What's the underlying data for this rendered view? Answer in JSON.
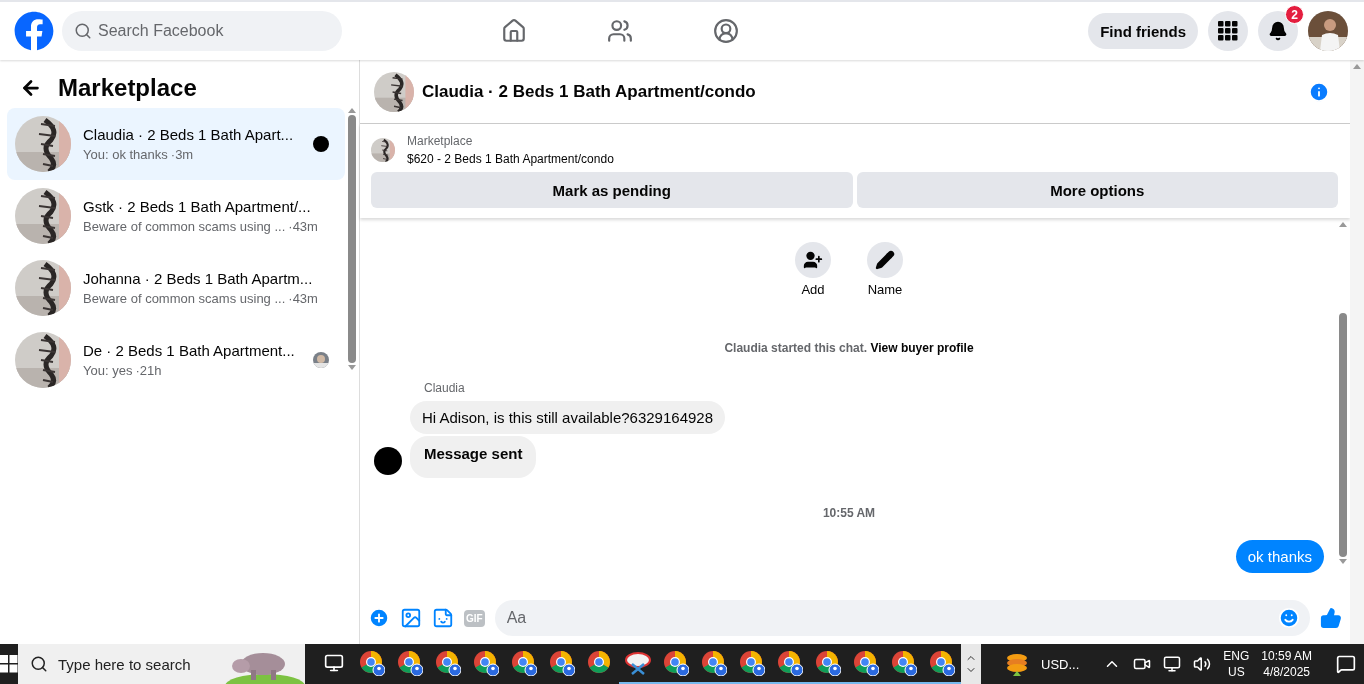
{
  "topbar": {
    "search": {
      "placeholder": "Search Facebook"
    },
    "find_friends": "Find friends",
    "notification_count": "2"
  },
  "sidebar": {
    "title": "Marketplace",
    "conversations": [
      {
        "title": "Claudia · 2 Beds 1 Bath Apart...",
        "preview": "You: ok thanks",
        "time": "·3m",
        "selected": true,
        "kind": "unread"
      },
      {
        "title": "Gstk · 2 Beds 1 Bath Apartment/...",
        "preview": "Beware of common scams using ...",
        "time": "·43m",
        "selected": false,
        "kind": "plain"
      },
      {
        "title": "Johanna · 2 Beds 1 Bath Apartm...",
        "preview": "Beware of common scams using ...",
        "time": "·43m",
        "selected": false,
        "kind": "plain"
      },
      {
        "title": "De · 2 Beds 1 Bath Apartment...",
        "preview": "You: yes",
        "time": "·21h",
        "selected": false,
        "kind": "seen"
      }
    ]
  },
  "chat": {
    "title": "Claudia · 2 Beds 1 Bath Apartment/condo",
    "listing": {
      "label": "Marketplace",
      "item": "$620 - 2 Beds 1 Bath Apartment/condo"
    },
    "actions": [
      "Mark as pending",
      "More options"
    ],
    "quick_actions": [
      {
        "kind": "add",
        "label": "Add"
      },
      {
        "kind": "name",
        "label": "Name"
      }
    ],
    "started": {
      "text": "Claudia started this chat.",
      "link": "View buyer profile"
    },
    "messages": [
      {
        "kind": "sender",
        "text": "Claudia"
      },
      {
        "kind": "incoming",
        "text": "Hi Adison, is this still available?6329164928"
      },
      {
        "kind": "incoming_bold",
        "text": "Message sent"
      },
      {
        "kind": "time",
        "text": "10:55 AM"
      },
      {
        "kind": "outgoing",
        "text": "ok thanks"
      }
    ],
    "composer": {
      "placeholder": "Aa",
      "gif": "GIF"
    }
  },
  "taskbar": {
    "search": {
      "placeholder": "Type here to search"
    },
    "apps": [
      {
        "kind": "chrome-profile",
        "open": false
      },
      {
        "kind": "chrome-profile",
        "open": false
      },
      {
        "kind": "chrome-profile",
        "open": false
      },
      {
        "kind": "chrome-profile",
        "open": false
      },
      {
        "kind": "chrome-profile",
        "open": false
      },
      {
        "kind": "chrome-profile",
        "open": false
      },
      {
        "kind": "chrome",
        "open": false
      },
      {
        "kind": "snip",
        "open": true
      },
      {
        "kind": "chrome-profile",
        "open": true
      },
      {
        "kind": "chrome-profile",
        "open": true
      },
      {
        "kind": "chrome-profile",
        "open": true
      },
      {
        "kind": "chrome-profile",
        "open": true
      },
      {
        "kind": "chrome-profile",
        "open": true
      },
      {
        "kind": "chrome-profile",
        "open": true
      },
      {
        "kind": "chrome-profile",
        "open": true
      },
      {
        "kind": "chrome-profile",
        "open": true
      }
    ],
    "currency": "USD...",
    "language": "ENG",
    "region": "US",
    "time": "10:59 AM",
    "date": "4/8/2025"
  }
}
